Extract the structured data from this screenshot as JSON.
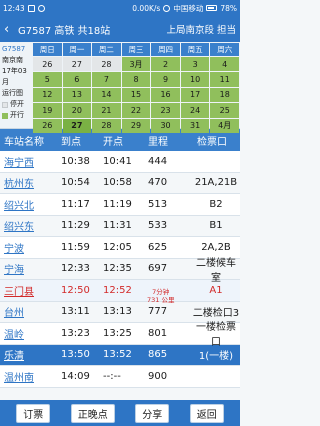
{
  "status_bar": {
    "time": "12:43",
    "net_speed": "0.00K/s",
    "carrier": "中国移动",
    "battery": "78%"
  },
  "header": {
    "back_glyph": "‹",
    "title": "G7587 高铁 共18站",
    "bureau": "上局南京段 担当"
  },
  "calendar": {
    "train_code": "G7587",
    "station": "南京南",
    "month": "17年03月",
    "status_title": "运行图",
    "legend_stop": "停开",
    "legend_run": "开行",
    "colors": {
      "run": "#90bf5c",
      "stop": "#e3e6e8",
      "head": "#3a80cc"
    },
    "weekdays": [
      "周日",
      "周一",
      "周二",
      "周三",
      "周四",
      "周五",
      "周六"
    ],
    "weeks": [
      [
        "26",
        "27",
        "28",
        "3月",
        "2",
        "3",
        "4"
      ],
      [
        "5",
        "6",
        "7",
        "8",
        "9",
        "10",
        "11"
      ],
      [
        "12",
        "13",
        "14",
        "15",
        "16",
        "17",
        "18"
      ],
      [
        "19",
        "20",
        "21",
        "22",
        "23",
        "24",
        "25"
      ],
      [
        "26",
        "27",
        "28",
        "29",
        "30",
        "31",
        "4月"
      ]
    ]
  },
  "table": {
    "headers": {
      "name": "车站名称",
      "arrive": "到点",
      "depart": "开点",
      "mileage": "里程",
      "check": "检票口"
    },
    "rows": [
      {
        "name": "海宁西",
        "arrive": "10:38",
        "depart": "10:41",
        "mileage": "444",
        "check": ""
      },
      {
        "name": "杭州东",
        "arrive": "10:54",
        "depart": "10:58",
        "mileage": "470",
        "check": "21A,21B"
      },
      {
        "name": "绍兴北",
        "arrive": "11:17",
        "depart": "11:19",
        "mileage": "513",
        "check": "B2"
      },
      {
        "name": "绍兴东",
        "arrive": "11:29",
        "depart": "11:31",
        "mileage": "533",
        "check": "B1"
      },
      {
        "name": "宁波",
        "arrive": "11:59",
        "depart": "12:05",
        "mileage": "625",
        "check": "2A,2B"
      },
      {
        "name": "宁海",
        "arrive": "12:33",
        "depart": "12:35",
        "mileage": "697",
        "check": "二楼候车室"
      },
      {
        "name": "三门县",
        "arrive": "12:50",
        "depart": "12:52",
        "mileage": "",
        "check": "A1",
        "delay_line1": "7分钟",
        "delay_line2": "731 公里"
      },
      {
        "name": "台州",
        "arrive": "13:11",
        "depart": "13:13",
        "mileage": "777",
        "check": "二楼检口3"
      },
      {
        "name": "温岭",
        "arrive": "13:23",
        "depart": "13:25",
        "mileage": "801",
        "check": "一楼检票口"
      },
      {
        "name": "乐清",
        "arrive": "13:50",
        "depart": "13:52",
        "mileage": "865",
        "check": "1(一楼)"
      },
      {
        "name": "温州南",
        "arrive": "14:09",
        "depart": "--:--",
        "mileage": "900",
        "check": ""
      }
    ]
  },
  "bottom_bar": {
    "ticket": "订票",
    "delay": "正晚点",
    "share": "分享",
    "back": "返回"
  }
}
